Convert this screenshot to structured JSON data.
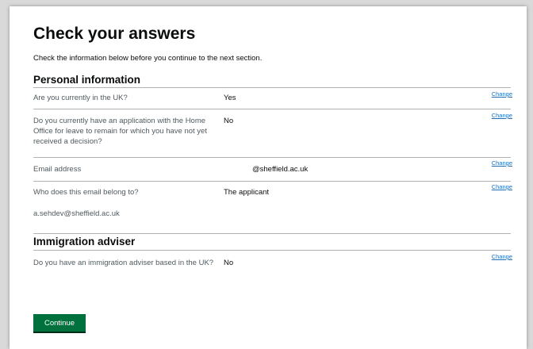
{
  "title": "Check your answers",
  "intro": "Check the information below before you continue to the next section.",
  "change_label": "Change",
  "sections": [
    {
      "heading": "Personal information",
      "rows": [
        {
          "key": "Are you currently in the UK?",
          "value": "Yes"
        },
        {
          "key": "Do you currently have an application with the Home Office for leave to remain for which you have not yet received a decision?",
          "value": "No"
        },
        {
          "key": "Email address",
          "value": "@sheffield.ac.uk"
        },
        {
          "key": "Who does this email belong to?",
          "value": "The applicant",
          "extra": "a.sehdev@sheffield.ac.uk"
        }
      ]
    },
    {
      "heading": "Immigration adviser",
      "rows": [
        {
          "key": "Do you have an immigration adviser based in the UK?",
          "value": "No"
        }
      ]
    }
  ],
  "continue_label": "Continue",
  "colors": {
    "button": "#00703c",
    "link": "#1d70b8",
    "text": "#0b0c0c",
    "secondary_text": "#505a5f",
    "border": "#b1b4b6"
  }
}
